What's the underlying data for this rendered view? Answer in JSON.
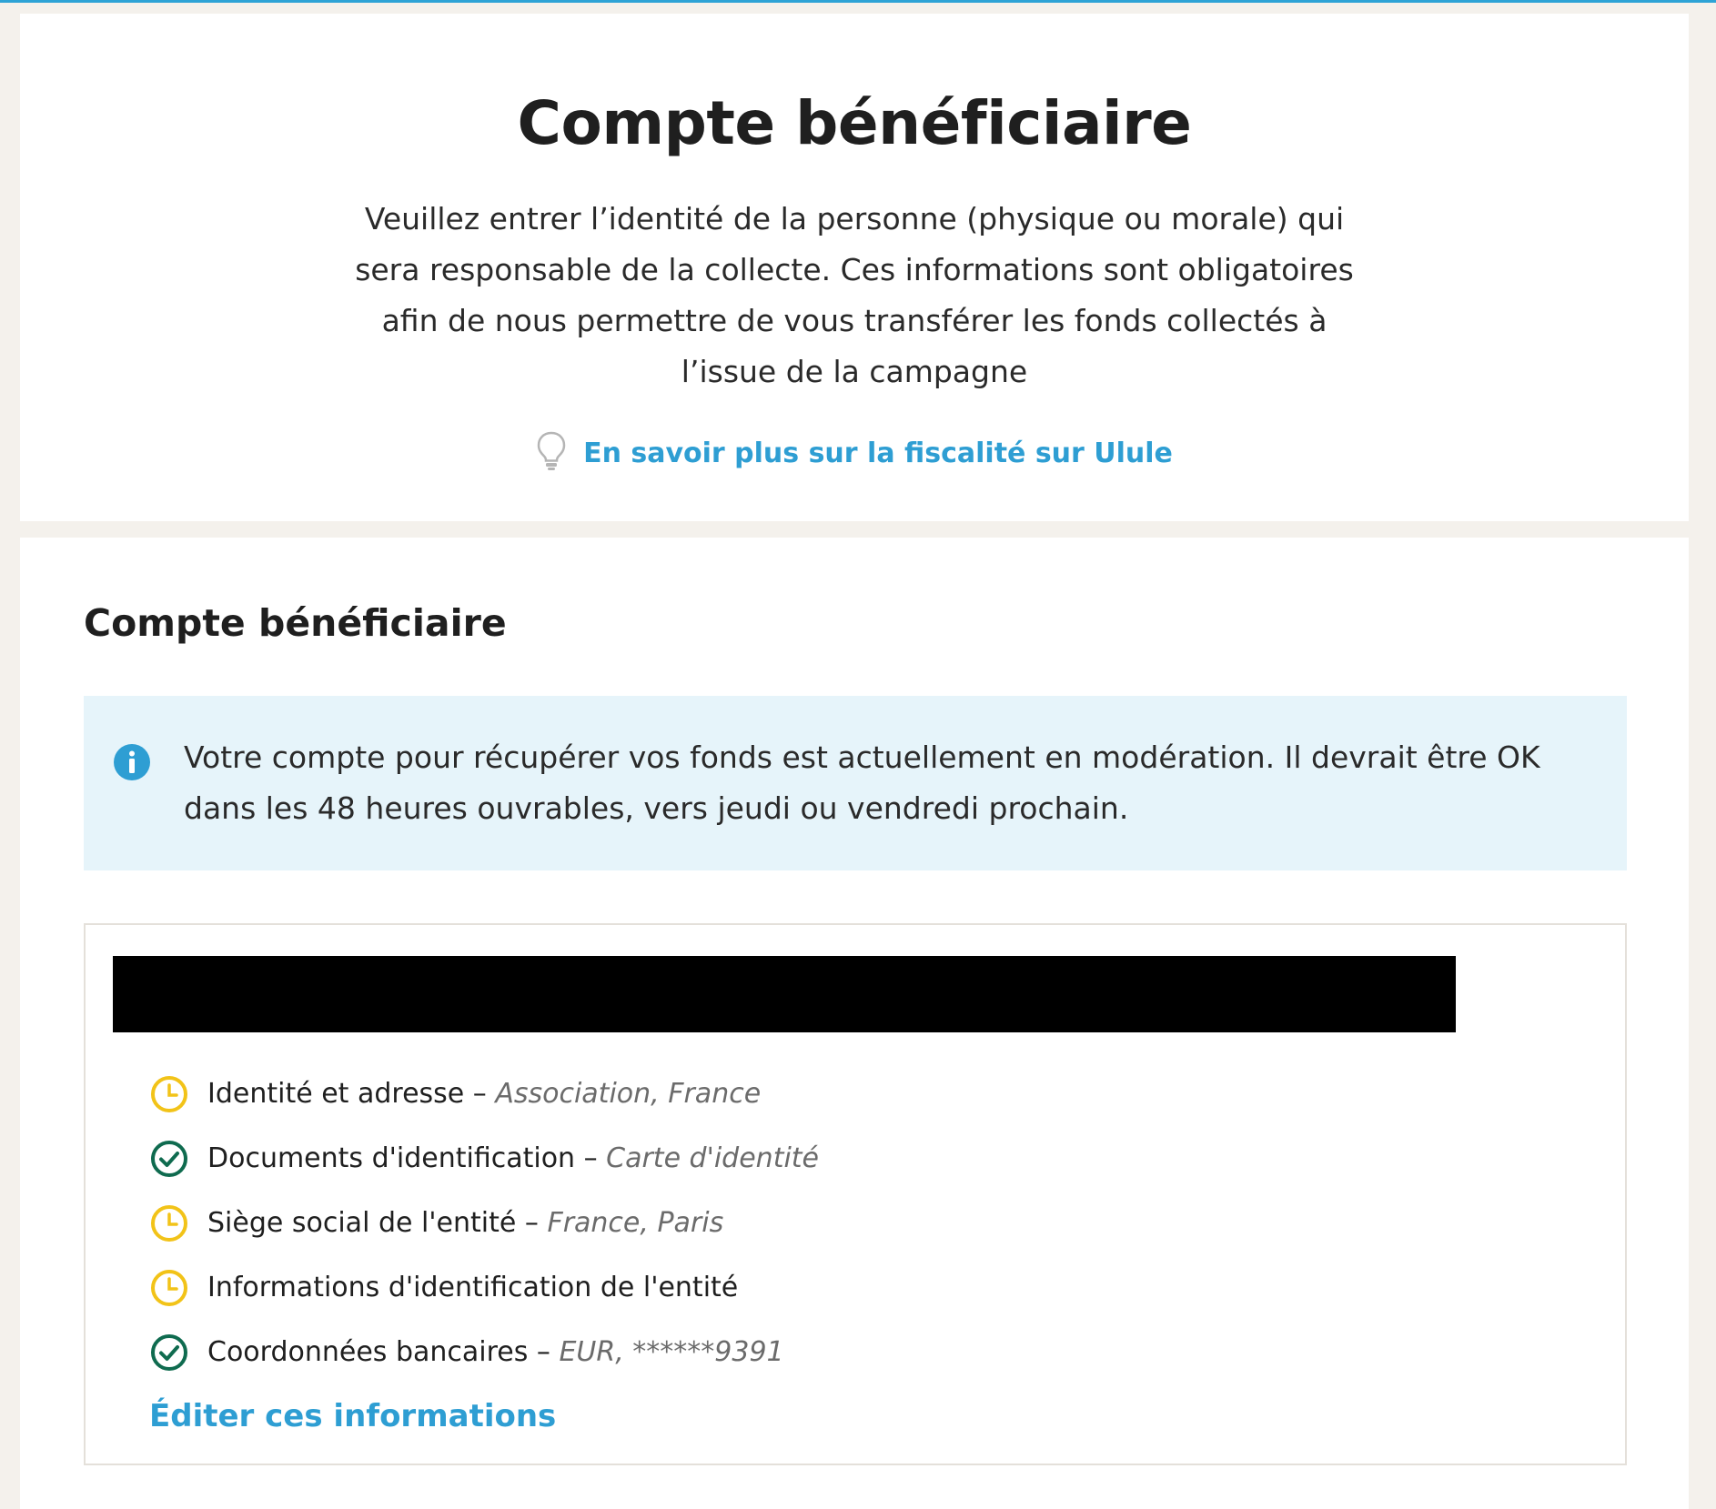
{
  "intro": {
    "title": "Compte bénéficiaire",
    "description": "Veuillez entrer l’identité de la personne (physique ou morale) qui sera responsable de la collecte. Ces informations sont obligatoires afin de nous permettre de vous transférer les fonds collectés à l’issue de la campagne",
    "link_icon": "lightbulb-icon",
    "link_label": "En savoir plus sur la fiscalité sur Ulule"
  },
  "main": {
    "section_title": "Compte bénéficiaire",
    "info_icon": "info-icon",
    "info_message": "Votre compte pour récupérer vos fonds est actuellement en modération. Il devrait être OK dans les 48 heures ouvrables, vers jeudi ou vendredi prochain.",
    "status_items": [
      {
        "label": "Identité et adresse",
        "separator": " – ",
        "detail": "Association, France",
        "status": "pending",
        "icon": "clock-icon"
      },
      {
        "label": "Documents d'identification",
        "separator": " – ",
        "detail": "Carte d'identité",
        "status": "validated",
        "icon": "check-circle-icon"
      },
      {
        "label": "Siège social de l'entité",
        "separator": " – ",
        "detail": "France, Paris",
        "status": "pending",
        "icon": "clock-icon"
      },
      {
        "label": "Informations d'identification de l'entité",
        "separator": "",
        "detail": "",
        "status": "pending",
        "icon": "clock-icon"
      },
      {
        "label": "Coordonnées bancaires",
        "separator": " – ",
        "detail": "EUR, ******9391",
        "status": "validated",
        "icon": "check-circle-icon"
      }
    ],
    "edit_label": "Éditer ces informations"
  },
  "colors": {
    "accent_blue": "#2e9ed3",
    "pending_yellow": "#f2c318",
    "validated_green": "#0f6b4f",
    "info_bg": "#e6f4fa",
    "page_bg": "#f4f1ec"
  }
}
